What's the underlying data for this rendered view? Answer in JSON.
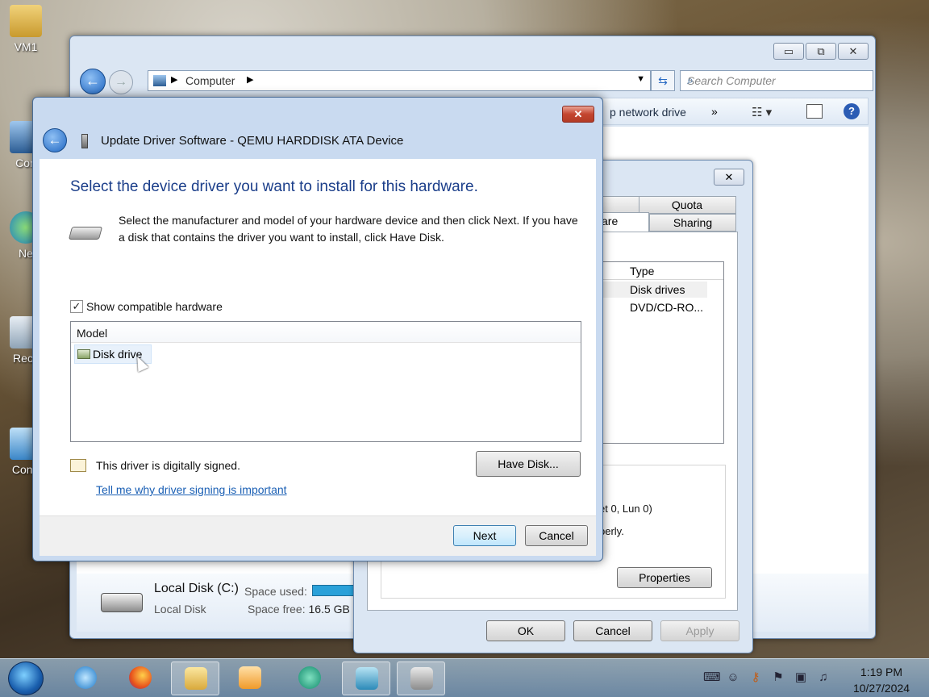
{
  "desktop": {
    "icons": [
      {
        "label": "VM1",
        "icon": "user-folder-icon"
      },
      {
        "label": "Con",
        "icon": "computer-icon"
      },
      {
        "label": "Ne",
        "icon": "network-icon"
      },
      {
        "label": "Recy",
        "icon": "recycle-bin-icon"
      },
      {
        "label": "Contr",
        "icon": "control-panel-icon"
      }
    ]
  },
  "explorer": {
    "address": "Computer",
    "search_placeholder": "Search Computer",
    "toolbar_network": "p network drive",
    "toolbar_more": "»",
    "details": {
      "name": "Local Disk (C:)",
      "subtitle": "Local Disk",
      "space_used_label": "Space used:",
      "space_free_label": "Space free:",
      "space_free_value": "16.5 GB"
    },
    "window_buttons": {
      "minimize": "▭",
      "maximize": "⧉",
      "close": "✕"
    }
  },
  "properties_dialog": {
    "close": "✕",
    "tabs": {
      "quota": "Quota",
      "sharing": "Sharing",
      "hardware_partial": "are"
    },
    "list_header_type": "Type",
    "list_rows": [
      "Disk drives",
      "DVD/CD-RO..."
    ],
    "info_line1": "et 0, Lun 0)",
    "info_line2": "perly.",
    "properties_button": "Properties",
    "ok": "OK",
    "cancel": "Cancel",
    "apply": "Apply"
  },
  "driver_dialog": {
    "title": "Update Driver Software - QEMU HARDDISK ATA Device",
    "close": "✕",
    "heading": "Select the device driver you want to install for this hardware.",
    "description": "Select the manufacturer and model of your hardware device and then click Next. If you have a disk that contains the driver you want to install, click Have Disk.",
    "show_compatible_label": "Show compatible hardware",
    "show_compatible_checked": true,
    "check_mark": "✓",
    "model_header": "Model",
    "models": [
      "Disk drive"
    ],
    "signed_text": "This driver is digitally signed.",
    "signing_link": "Tell me why driver signing is important",
    "have_disk": "Have Disk...",
    "next": "Next",
    "cancel": "Cancel"
  },
  "taskbar": {
    "apps": [
      "internet-explorer-icon",
      "firefox-icon",
      "file-explorer-icon",
      "media-player-icon",
      "chat-icon",
      "registry-editor-icon",
      "device-manager-icon"
    ],
    "time": "1:19 PM",
    "date": "10/27/2024"
  },
  "colors": {
    "accent": "#1b3e8a",
    "link": "#1a5fb4",
    "close_red": "#c4452f"
  }
}
